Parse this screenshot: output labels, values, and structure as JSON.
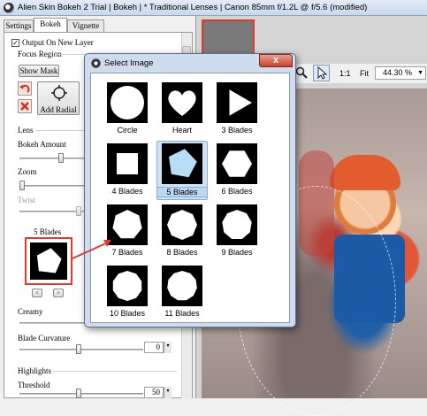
{
  "window": {
    "title": "Alien Skin Bokeh 2 Trial | Bokeh | * Traditional Lenses | Canon  85mm f/1.2L @ f/5.6 (modified)"
  },
  "tabs": [
    {
      "label": "Settings"
    },
    {
      "label": "Bokeh"
    },
    {
      "label": "Vignette"
    }
  ],
  "panel": {
    "output_checkbox": "Output On New Layer",
    "focus_region": "Focus Region",
    "show_mask": "Show Mask",
    "add_radial": "Add Radial",
    "lens": "Lens",
    "bokeh_amount": "Bokeh Amount",
    "zoom": "Zoom",
    "twist": "Twist",
    "blades_label": "5 Blades",
    "creamy": "Creamy",
    "blade_curvature": "Blade Curvature",
    "blade_curvature_value": "0",
    "highlights": "Highlights",
    "threshold": "Threshold",
    "threshold_value": "50",
    "prev_arrow": "<",
    "next_arrow": ">"
  },
  "toolbar": {
    "zoom_1to1": "1:1",
    "fit": "Fit",
    "zoom_value": "44.30 %"
  },
  "dialog": {
    "title": "Select Image",
    "close": "x",
    "items": [
      {
        "label": "Circle",
        "shape": "circle"
      },
      {
        "label": "Heart",
        "shape": "heart"
      },
      {
        "label": "3 Blades",
        "shape": "3"
      },
      {
        "label": "4 Blades",
        "shape": "4"
      },
      {
        "label": "5 Blades",
        "shape": "5",
        "selected": true
      },
      {
        "label": "6 Blades",
        "shape": "6"
      },
      {
        "label": "7 Blades",
        "shape": "7"
      },
      {
        "label": "8 Blades",
        "shape": "8"
      },
      {
        "label": "9 Blades",
        "shape": "9"
      },
      {
        "label": "10 Blades",
        "shape": "10"
      },
      {
        "label": "11 Blades",
        "shape": "11"
      }
    ]
  },
  "colors": {
    "accent_red": "#e2392f",
    "selection": "#cde3f8",
    "polygon_selected": "#b9dcf6"
  }
}
